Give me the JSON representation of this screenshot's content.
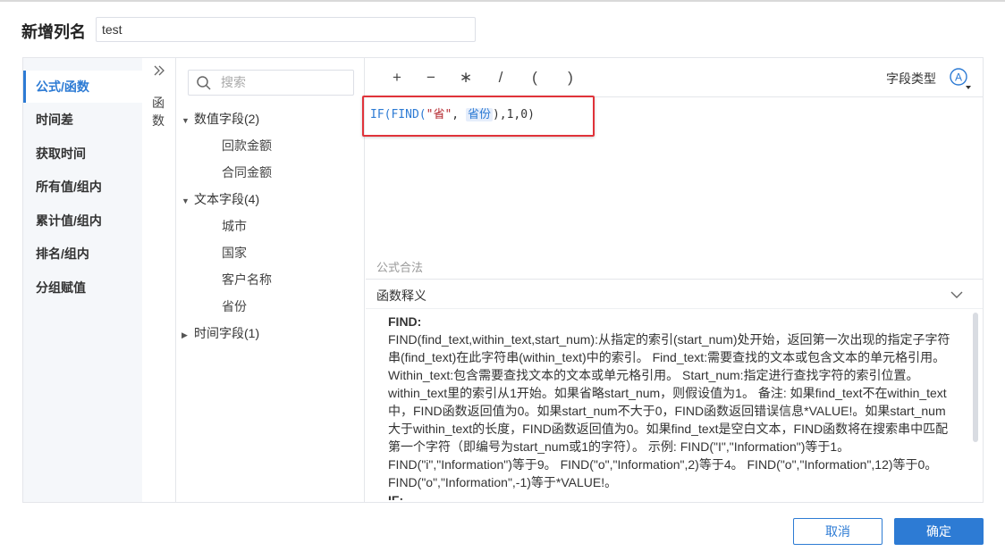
{
  "dialog": {
    "title": "新增列名",
    "name_value": "test"
  },
  "categories": [
    {
      "label": "公式/函数"
    },
    {
      "label": "时间差"
    },
    {
      "label": "获取时间"
    },
    {
      "label": "所有值/组内"
    },
    {
      "label": "累计值/组内"
    },
    {
      "label": "排名/组内"
    },
    {
      "label": "分组赋值"
    }
  ],
  "function_column": {
    "toggle_icon": "double-chevron-right",
    "label_1": "函",
    "label_2": "数"
  },
  "field_tree": {
    "search_placeholder": "搜索",
    "groups": [
      {
        "label": "数值字段(2)",
        "expanded": true,
        "items": [
          "回款金额",
          "合同金额"
        ]
      },
      {
        "label": "文本字段(4)",
        "expanded": true,
        "items": [
          "城市",
          "国家",
          "客户名称",
          "省份"
        ]
      },
      {
        "label": "时间字段(1)",
        "expanded": false,
        "items": []
      }
    ]
  },
  "operators": [
    "+",
    "−",
    "∗",
    "/",
    "(",
    ")"
  ],
  "field_type": {
    "label": "字段类型",
    "icon": "text-type-icon"
  },
  "formula": {
    "part1": "IF(FIND(",
    "string_literal": "\"省\"",
    "sep": ", ",
    "field": "省份",
    "part2": "),1,0)"
  },
  "validation_message": "公式合法",
  "description": {
    "title": "函数释义",
    "function_name": "FIND:",
    "text": "FIND(find_text,within_text,start_num):从指定的索引(start_num)处开始，返回第一次出现的指定子字符串(find_text)在此字符串(within_text)中的索引。 Find_text:需要查找的文本或包含文本的单元格引用。 Within_text:包含需要查找文本的文本或单元格引用。 Start_num:指定进行查找字符的索引位置。within_text里的索引从1开始。如果省略start_num，则假设值为1。 备注: 如果find_text不在within_text中，FIND函数返回值为0。如果start_num不大于0，FIND函数返回错误信息*VALUE!。如果start_num大于within_text的长度，FIND函数返回值为0。如果find_text是空白文本，FIND函数将在搜索串中匹配第一个字符（即编号为start_num或1的字符）。 示例: FIND(\"I\",\"Information\")等于1。 FIND(\"i\",\"Information\")等于9。 FIND(\"o\",\"Information\",2)等于4。 FIND(\"o\",\"Information\",12)等于0。 FIND(\"o\",\"Information\",-1)等于*VALUE!。",
    "next_function_name": "IF:"
  },
  "buttons": {
    "cancel": "取消",
    "ok": "确定"
  },
  "colors": {
    "accent": "#2d7bd4",
    "highlight_border": "#e0333a"
  }
}
